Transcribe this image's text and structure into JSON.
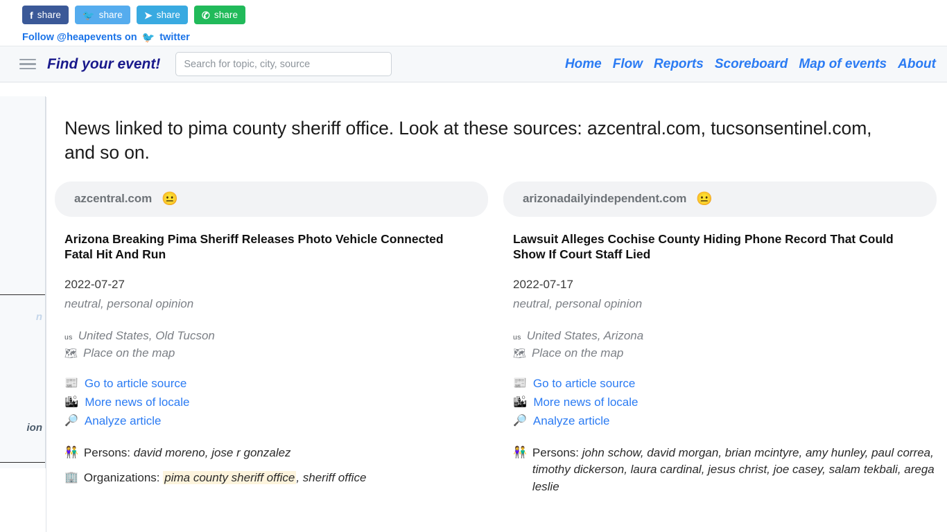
{
  "share_bar": {
    "buttons": [
      {
        "network": "facebook",
        "glyph": "f",
        "label": "share",
        "color": "#3b5998"
      },
      {
        "network": "twitter",
        "glyph": "🐦",
        "label": "share",
        "color": "#55acee"
      },
      {
        "network": "telegram",
        "glyph": "✈",
        "label": "share",
        "color": "#39aae1"
      },
      {
        "network": "whatsapp",
        "glyph": "✆",
        "label": "share",
        "color": "#21ba5a"
      }
    ]
  },
  "follow": {
    "prefix": "Follow @heapevents on",
    "bird_emoji": "🐦",
    "network": "twitter"
  },
  "navbar": {
    "menu_icon": "hamburger-icon",
    "brand": "Find your event!",
    "search_placeholder": "Search for topic, city, source",
    "search_value": "",
    "links": [
      "Home",
      "Flow",
      "Reports",
      "Scoreboard",
      "Map of events",
      "About"
    ]
  },
  "offcanvas": {
    "faint_fragment": "n",
    "strong_fragment": "ion"
  },
  "main": {
    "heading": "News linked to pima county sheriff office. Look at these sources: azcentral.com, tucsonsentinel.com, and so on.",
    "cards": [
      {
        "source": "azcentral.com",
        "sentiment_emoji": "😐",
        "title": "Arizona Breaking Pima Sheriff Releases Photo Vehicle Connected Fatal Hit And Run",
        "date": "2022-07-27",
        "tone": "neutral, personal opinion",
        "country_code": "us",
        "location": "United States, Old Tucson",
        "map_icon": "🗺",
        "map_label": "Place on the map",
        "links": [
          {
            "icon": "📰",
            "icon_name": "newspaper-icon",
            "label": "Go to article source"
          },
          {
            "icon": "🏙",
            "icon_name": "cityscape-icon",
            "label": "More news of locale"
          },
          {
            "icon": "🔎",
            "icon_name": "magnifier-icon",
            "label": "Analyze article"
          }
        ],
        "persons_icon": "👫",
        "persons_label": "Persons:",
        "persons": "david moreno, jose r gonzalez",
        "orgs_icon": "🏢",
        "orgs_label": "Organizations:",
        "orgs_highlight": "pima county sheriff office",
        "orgs_rest": ", sheriff office"
      },
      {
        "source": "arizonadailyindependent.com",
        "sentiment_emoji": "😐",
        "title": "Lawsuit Alleges Cochise County Hiding Phone Record That Could Show If Court Staff Lied",
        "date": "2022-07-17",
        "tone": "neutral, personal opinion",
        "country_code": "us",
        "location": "United States, Arizona",
        "map_icon": "🗺",
        "map_label": "Place on the map",
        "links": [
          {
            "icon": "📰",
            "icon_name": "newspaper-icon",
            "label": "Go to article source"
          },
          {
            "icon": "🏙",
            "icon_name": "cityscape-icon",
            "label": "More news of locale"
          },
          {
            "icon": "🔎",
            "icon_name": "magnifier-icon",
            "label": "Analyze article"
          }
        ],
        "persons_icon": "👫",
        "persons_label": "Persons:",
        "persons": "john schow, david morgan, brian mcintyre, amy hunley, paul correa, timothy dickerson, laura cardinal, jesus christ, joe casey, salam tekbali, arega leslie",
        "orgs_icon": "",
        "orgs_label": "",
        "orgs_highlight": "",
        "orgs_rest": ""
      }
    ]
  },
  "colors": {
    "brand_navy": "#1a1a8c",
    "link_blue": "#2b7bf3",
    "pill_gray": "#f2f3f5",
    "highlight_cream": "#fdf4dd"
  }
}
